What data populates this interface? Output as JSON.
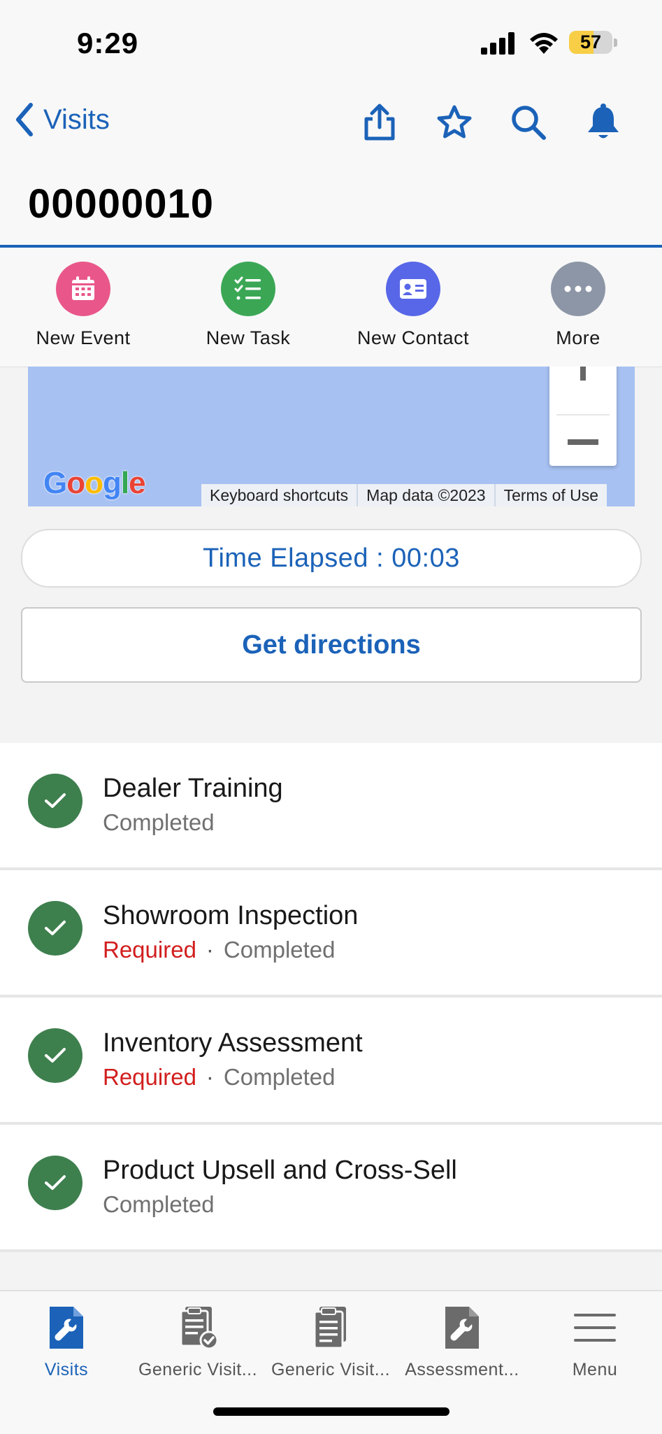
{
  "status_bar": {
    "time": "9:29",
    "battery": "57",
    "battery_level": 0.57
  },
  "nav": {
    "back_label": "Visits",
    "record_title": "00000010"
  },
  "quick_actions": [
    {
      "label": "New Event",
      "color": "#e9578a",
      "icon": "calendar-icon"
    },
    {
      "label": "New Task",
      "color": "#3ba755",
      "icon": "task-list-icon"
    },
    {
      "label": "New Contact",
      "color": "#5867e8",
      "icon": "contact-card-icon"
    },
    {
      "label": "More",
      "color": "#8c96a6",
      "icon": "more-dots-icon"
    }
  ],
  "map": {
    "logo": "Google",
    "footer": [
      "Keyboard shortcuts",
      "Map data ©2023",
      "Terms of Use"
    ]
  },
  "timer": {
    "text": "Time Elapsed : 00:03"
  },
  "directions": {
    "label": "Get directions"
  },
  "tasks": [
    {
      "title": "Dealer Training",
      "required": "",
      "status": "Completed"
    },
    {
      "title": "Showroom Inspection",
      "required": "Required",
      "separator": "·",
      "status": "Completed"
    },
    {
      "title": "Inventory Assessment",
      "required": "Required",
      "separator": "·",
      "status": "Completed"
    },
    {
      "title": "Product Upsell and Cross-Sell",
      "required": "",
      "status": "Completed"
    }
  ],
  "tab_bar": [
    {
      "label": "Visits",
      "icon": "wrench-icon",
      "active": true
    },
    {
      "label": "Generic Visit...",
      "icon": "clipboard-check-icon"
    },
    {
      "label": "Generic Visit...",
      "icon": "clipboard-icon"
    },
    {
      "label": "Assessment...",
      "icon": "wrench-doc-icon"
    },
    {
      "label": "Menu",
      "icon": "hamburger-icon"
    }
  ],
  "colors": {
    "brand_blue": "#1b62b8",
    "success_green": "#3e7f4e",
    "required_red": "#d21e1e",
    "map_water": "#a7c1f2"
  }
}
